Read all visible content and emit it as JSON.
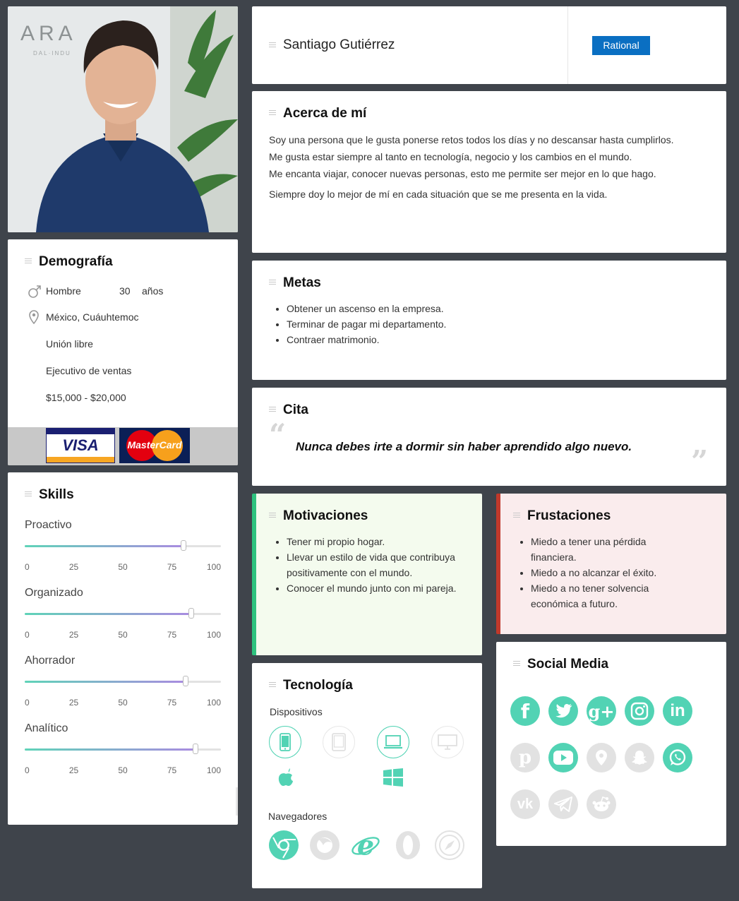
{
  "profile": {
    "name": "Santiago Gutiérrez",
    "badge": "Rational",
    "photo_wall_text": "ARA",
    "photo_wall_subtext": "DAL·INDU"
  },
  "about": {
    "title": "Acerca de mí",
    "lines": [
      "Soy una persona que le gusta ponerse retos todos los días y no descansar hasta cumplirlos.",
      "Me gusta estar siempre al tanto en tecnología, negocio y los cambios en el mundo.",
      "Me encanta viajar, conocer nuevas personas, esto me permite ser mejor en lo que hago.",
      "Siempre doy lo mejor de mí en cada situación que se me presenta en la vida."
    ]
  },
  "demographics": {
    "title": "Demografía",
    "gender": "Hombre",
    "age": "30",
    "age_unit": "años",
    "location": "México, Cuáuhtemoc",
    "marital_status": "Unión libre",
    "job": "Ejecutivo de ventas",
    "income": "$15,000 - $20,000",
    "cards": [
      "VISA",
      "MasterCard"
    ]
  },
  "goals": {
    "title": "Metas",
    "items": [
      "Obtener un ascenso en la empresa.",
      "Terminar de pagar mi departamento.",
      "Contraer matrimonio."
    ]
  },
  "quote": {
    "title": "Cita",
    "text": "Nunca debes irte a dormir sin haber aprendido algo nuevo.",
    "open_mark": "“",
    "close_mark": "”"
  },
  "skills": {
    "title": "Skills",
    "tick_labels": [
      "0",
      "25",
      "50",
      "75",
      "100"
    ],
    "items": [
      {
        "label": "Proactivo",
        "value": 81
      },
      {
        "label": "Organizado",
        "value": 85
      },
      {
        "label": "Ahorrador",
        "value": 82
      },
      {
        "label": "Analítico",
        "value": 87
      }
    ]
  },
  "motivations": {
    "title": "Motivaciones",
    "accent": "#2ec27e",
    "items": [
      "Tener mi propio hogar.",
      "Llevar un estilo de vida que contribuya positivamente con el mundo.",
      "Conocer el mundo junto con mi pareja."
    ]
  },
  "frustrations": {
    "title": "Frustaciones",
    "accent": "#c0392b",
    "items": [
      "Miedo a tener una pérdida financiera.",
      "Miedo a no alcanzar el éxito.",
      "Miedo a no tener solvencia económica a futuro."
    ]
  },
  "technology": {
    "title": "Tecnología",
    "devices_label": "Dispositivos",
    "browsers_label": "Navegadores",
    "devices": [
      {
        "icon": "smartphone-icon",
        "active": true
      },
      {
        "icon": "tablet-icon",
        "active": false
      },
      {
        "icon": "laptop-icon",
        "active": true
      },
      {
        "icon": "desktop-monitor-icon",
        "active": false
      }
    ],
    "os": [
      "apple-icon",
      "windows-icon"
    ],
    "browsers": [
      {
        "icon": "chrome-icon",
        "active": true
      },
      {
        "icon": "firefox-icon",
        "active": false
      },
      {
        "icon": "internet-explorer-icon",
        "active": true
      },
      {
        "icon": "opera-icon",
        "active": false
      },
      {
        "icon": "safari-icon",
        "active": false
      }
    ]
  },
  "social": {
    "title": "Social Media",
    "networks": [
      {
        "icon": "facebook-icon",
        "glyph": "f",
        "active": true
      },
      {
        "icon": "twitter-icon",
        "glyph": "t",
        "active": true
      },
      {
        "icon": "google-plus-icon",
        "glyph": "g+",
        "active": true
      },
      {
        "icon": "instagram-icon",
        "glyph": "",
        "active": true
      },
      {
        "icon": "linkedin-icon",
        "glyph": "in",
        "active": true
      },
      {
        "icon": "pinterest-icon",
        "glyph": "p",
        "active": false
      },
      {
        "icon": "youtube-icon",
        "glyph": "",
        "active": true
      },
      {
        "icon": "foursquare-icon",
        "glyph": "",
        "active": false
      },
      {
        "icon": "snapchat-icon",
        "glyph": "",
        "active": false
      },
      {
        "icon": "whatsapp-icon",
        "glyph": "",
        "active": true
      },
      {
        "icon": "vk-icon",
        "glyph": "vk",
        "active": false
      },
      {
        "icon": "telegram-icon",
        "glyph": "",
        "active": false
      },
      {
        "icon": "reddit-icon",
        "glyph": "",
        "active": false
      }
    ],
    "active_color": "#52d3b4",
    "inactive_color": "#e2e2e2"
  },
  "colors": {
    "background": "#3f444b",
    "badge": "#0a6fc2",
    "accent_teal": "#52d3b4"
  }
}
